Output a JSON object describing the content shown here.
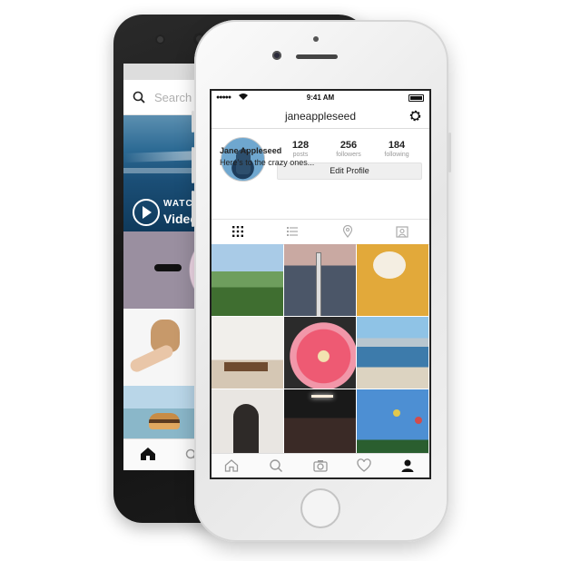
{
  "back_phone": {
    "search": {
      "placeholder": "Search"
    },
    "video_tile": {
      "label": "WATCH",
      "title": "Video"
    },
    "nav": {
      "home_icon": "home-icon",
      "search_icon": "search-icon"
    }
  },
  "front_phone": {
    "status": {
      "time": "9:41 AM",
      "signal": "●●●●●"
    },
    "header": {
      "username": "janeappleseed",
      "settings_icon": "gear-icon"
    },
    "profile": {
      "stats": [
        {
          "value": "128",
          "label": "posts"
        },
        {
          "value": "256",
          "label": "followers"
        },
        {
          "value": "184",
          "label": "following"
        }
      ],
      "edit_button": "Edit Profile",
      "full_name": "Jane Appleseed",
      "bio": "Here's to the crazy ones..."
    },
    "view_tabs": [
      "grid-icon",
      "list-icon",
      "location-pin-icon",
      "tagged-photos-icon"
    ],
    "photos": [
      "park",
      "bridge",
      "cat",
      "room",
      "flower",
      "lake",
      "girl",
      "concert",
      "ride"
    ],
    "bottom_nav": [
      "home-icon",
      "search-icon",
      "camera-icon",
      "heart-icon",
      "profile-icon"
    ]
  }
}
